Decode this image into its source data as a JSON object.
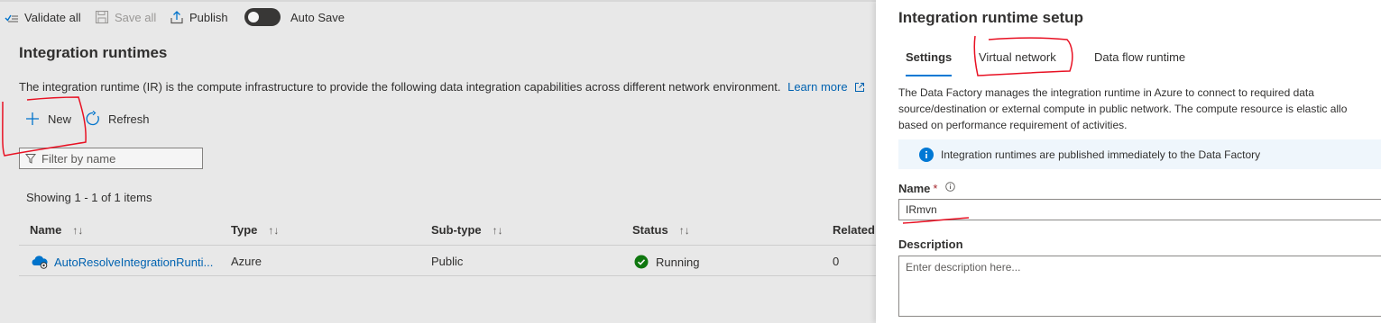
{
  "toolbar": {
    "validate_all": "Validate all",
    "save_all": "Save all",
    "publish": "Publish",
    "auto_save": "Auto Save"
  },
  "main": {
    "title": "Integration runtimes",
    "description": "The integration runtime (IR) is the compute infrastructure to provide the following data integration capabilities across different network environment.",
    "learn_more": "Learn more",
    "new_label": "New",
    "refresh_label": "Refresh",
    "filter_placeholder": "Filter by name",
    "count_text": "Showing 1 - 1 of 1 items",
    "columns": [
      "Name",
      "Type",
      "Sub-type",
      "Status",
      "Related"
    ],
    "rows": [
      {
        "name": "AutoResolveIntegrationRunti...",
        "type": "Azure",
        "subtype": "Public",
        "status": "Running",
        "related": "0"
      }
    ]
  },
  "panel": {
    "title": "Integration runtime setup",
    "tabs": [
      "Settings",
      "Virtual network",
      "Data flow runtime"
    ],
    "active_tab": "Settings",
    "description_lines": [
      "The Data Factory manages the integration runtime in Azure to connect to required data",
      "source/destination or external compute in public network. The compute resource is elastic allo",
      "based on performance requirement of activities."
    ],
    "info_text": "Integration runtimes are published immediately to the Data Factory",
    "name_label": "Name",
    "required_mark": "*",
    "name_value": "IRmvn",
    "description_label": "Description",
    "description_placeholder": "Enter description here..."
  },
  "colors": {
    "accent": "#0078d4",
    "link": "#0067b8",
    "success": "#107c10",
    "annotation": "#e81123",
    "info_bar": "#eff6fc"
  },
  "icons": {
    "validate": "checkmark-list-icon",
    "save": "save-icon",
    "publish": "upload-icon",
    "new": "plus-icon",
    "refresh": "refresh-icon",
    "filter": "funnel-icon",
    "external_link": "external-link-icon",
    "runtime": "cloud-icon",
    "status": "check-circle-icon",
    "info": "info-circle-icon"
  }
}
